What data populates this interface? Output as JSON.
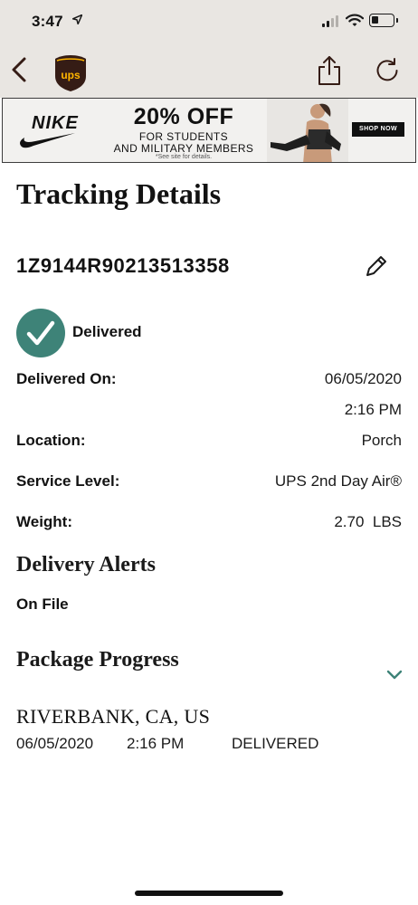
{
  "status_bar": {
    "time": "3:47"
  },
  "ad": {
    "brand": "NIKE",
    "headline": "20% OFF",
    "line1": "FOR STUDENTS",
    "line2": "AND MILITARY MEMBERS",
    "fine_print": "*See site for details.",
    "cta": "SHOP NOW"
  },
  "page": {
    "title": "Tracking Details"
  },
  "shipment": {
    "tracking_number": "1Z9144R90213513358",
    "status": "Delivered",
    "status_color": "#3e8378",
    "details": {
      "delivered_on_label": "Delivered On:",
      "delivered_on_date": "06/05/2020",
      "delivered_on_time": "2:16 PM",
      "location_label": "Location:",
      "location_value": "Porch",
      "service_label": "Service Level:",
      "service_value": "UPS 2nd Day Air®",
      "weight_label": "Weight:",
      "weight_value": "2.70  LBS"
    }
  },
  "alerts": {
    "heading": "Delivery Alerts",
    "value": "On File"
  },
  "progress": {
    "heading": "Package Progress",
    "events": [
      {
        "location": "RIVERBANK, CA, US",
        "date": "06/05/2020",
        "time": "2:16 PM",
        "status": "DELIVERED"
      }
    ]
  },
  "colors": {
    "header_bg": "#e9e6e2",
    "accent": "#3e8378",
    "ups_brown": "#351c15",
    "ups_gold": "#ffb500"
  },
  "icons": [
    "back-chevron-icon",
    "ups-logo",
    "share-icon",
    "refresh-icon",
    "pencil-icon",
    "checkmark-icon",
    "chevron-down-icon"
  ]
}
